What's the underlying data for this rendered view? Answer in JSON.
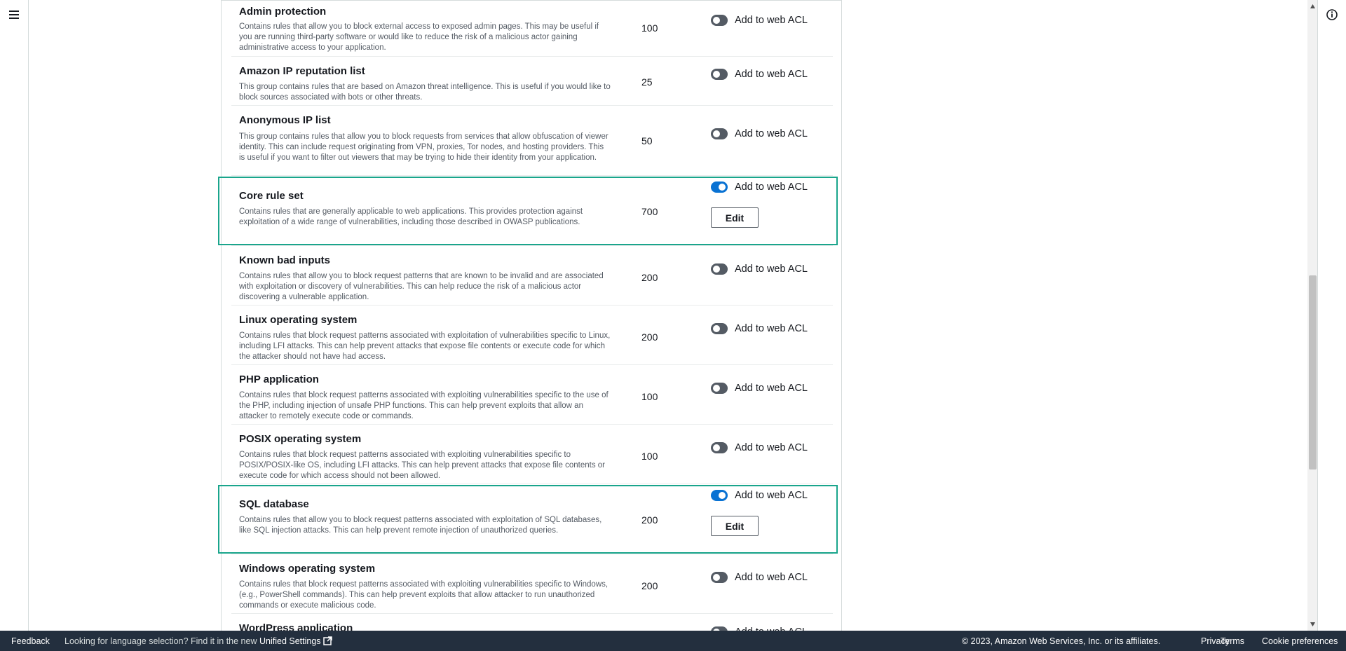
{
  "rules": [
    {
      "title": "Admin protection",
      "description": "Contains rules that allow you to block external access to exposed admin pages. This may be useful if you are running third-party software or would like to reduce the risk of a malicious actor gaining administrative access to your application.",
      "wcu": "100",
      "enabled": false
    },
    {
      "title": "Amazon IP reputation list",
      "description": "This group contains rules that are based on Amazon threat intelligence. This is useful if you would like to block sources associated with bots or other threats.",
      "wcu": "25",
      "enabled": false
    },
    {
      "title": "Anonymous IP list",
      "description": "This group contains rules that allow you to block requests from services that allow obfuscation of viewer identity. This can include request originating from VPN, proxies, Tor nodes, and hosting providers. This is useful if you want to filter out viewers that may be trying to hide their identity from your application.",
      "wcu": "50",
      "enabled": false
    },
    {
      "title": "Core rule set",
      "description": "Contains rules that are generally applicable to web applications. This provides protection against exploitation of a wide range of vulnerabilities, including those described in OWASP publications.",
      "wcu": "700",
      "enabled": true
    },
    {
      "title": "Known bad inputs",
      "description": "Contains rules that allow you to block request patterns that are known to be invalid and are associated with exploitation or discovery of vulnerabilities. This can help reduce the risk of a malicious actor discovering a vulnerable application.",
      "wcu": "200",
      "enabled": false
    },
    {
      "title": "Linux operating system",
      "description": "Contains rules that block request patterns associated with exploitation of vulnerabilities specific to Linux, including LFI attacks. This can help prevent attacks that expose file contents or execute code for which the attacker should not have had access.",
      "wcu": "200",
      "enabled": false
    },
    {
      "title": "PHP application",
      "description": "Contains rules that block request patterns associated with exploiting vulnerabilities specific to the use of the PHP, including injection of unsafe PHP functions. This can help prevent exploits that allow an attacker to remotely execute code or commands.",
      "wcu": "100",
      "enabled": false
    },
    {
      "title": "POSIX operating system",
      "description": "Contains rules that block request patterns associated with exploiting vulnerabilities specific to POSIX/POSIX-like OS, including LFI attacks. This can help prevent attacks that expose file contents or execute code for which access should not been allowed.",
      "wcu": "100",
      "enabled": false
    },
    {
      "title": "SQL database",
      "description": "Contains rules that allow you to block request patterns associated with exploitation of SQL databases, like SQL injection attacks. This can help prevent remote injection of unauthorized queries.",
      "wcu": "200",
      "enabled": true
    },
    {
      "title": "Windows operating system",
      "description": "Contains rules that block request patterns associated with exploiting vulnerabilities specific to Windows, (e.g., PowerShell commands). This can help prevent exploits that allow attacker to run unauthorized commands or execute malicious code.",
      "wcu": "200",
      "enabled": false
    },
    {
      "title": "WordPress application",
      "description": "",
      "wcu": "",
      "enabled": false
    }
  ],
  "toggle_label": "Add to web ACL",
  "edit_label": "Edit",
  "footer": {
    "feedback": "Feedback",
    "language_message": "Looking for language selection? Find it in the new",
    "unified_settings": "Unified Settings",
    "copyright": "© 2023, Amazon Web Services, Inc. or its affiliates.",
    "privacy": "Privacy",
    "terms": "Terms",
    "cookie_preferences": "Cookie preferences"
  },
  "colors": {
    "toggle_on": "#0972d3",
    "toggle_off": "#545b64",
    "highlight": "#1aa58c",
    "footer_bg": "#232f3e"
  }
}
